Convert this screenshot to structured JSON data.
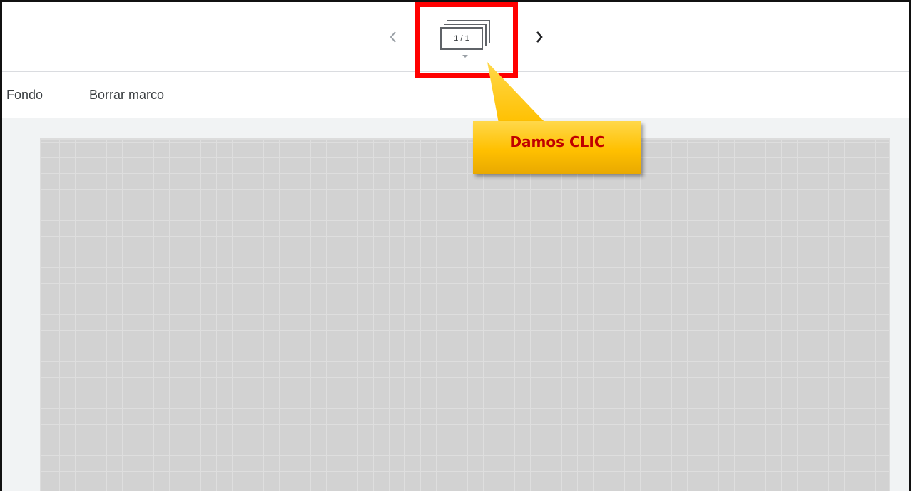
{
  "topbar": {
    "prev_icon": "chevron-left-icon",
    "next_icon": "chevron-right-icon",
    "frame_counter": {
      "label": "1 / 1",
      "icon": "stacked-frames-icon",
      "dropdown_icon": "caret-down-icon"
    }
  },
  "toolbar": {
    "fondo_label": "Fondo",
    "borrar_label": "Borrar marco"
  },
  "annotation": {
    "callout_text": "Damos CLIC",
    "highlight_color": "#ff0000",
    "callout_color": "#ffc000",
    "callout_text_color": "#c00000"
  },
  "canvas": {
    "grid": true,
    "background_color": "#d2d2d2"
  }
}
